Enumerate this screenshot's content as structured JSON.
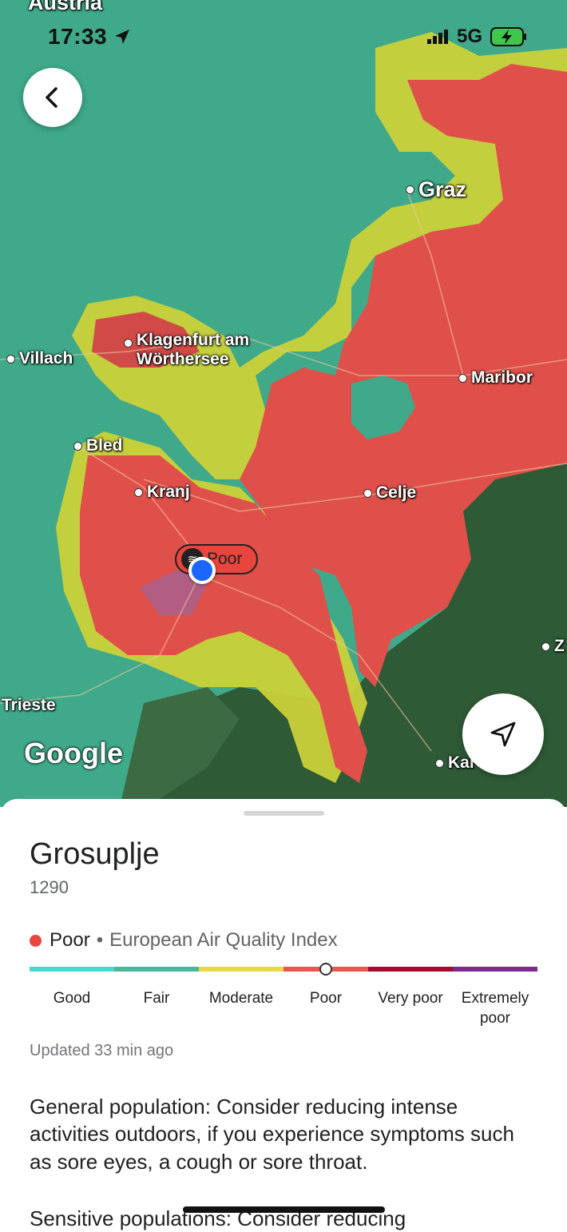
{
  "status_bar": {
    "time": "17:33",
    "network": "5G"
  },
  "map": {
    "top_label": "Austria",
    "cities": {
      "graz": "Graz",
      "klagenfurt": "Klagenfurt am\nWörthersee",
      "villach": "Villach",
      "maribor": "Maribor",
      "bled": "Bled",
      "kranj": "Kranj",
      "celje": "Celje",
      "trieste": "Trieste",
      "karlovac": "Kar",
      "zagreb": "Z"
    },
    "marker_label": "Poor",
    "attribution": "Google",
    "colors": {
      "good": "#3fa98a",
      "moderate": "#d8d43a",
      "poor": "#e0504a",
      "forest": "#2f5a36"
    }
  },
  "sheet": {
    "place": "Grosuplje",
    "postal": "1290",
    "status": "Poor",
    "separator": "•",
    "index_name": "European Air Quality Index",
    "scale": [
      {
        "label": "Good",
        "color": "#4fd6cc"
      },
      {
        "label": "Fair",
        "color": "#48b79a"
      },
      {
        "label": "Moderate",
        "color": "#e7d94a"
      },
      {
        "label": "Poor",
        "color": "#e8574f"
      },
      {
        "label": "Very poor",
        "color": "#9b1030"
      },
      {
        "label": "Extremely poor",
        "color": "#7a2a8c"
      }
    ],
    "current_level_fraction": 0.583,
    "updated": "Updated 33 min ago",
    "advice_general": "General population: Consider reducing intense activities outdoors, if you experience symptoms such as sore eyes, a cough or sore throat.",
    "advice_sensitive": "Sensitive populations: Consider reducing"
  },
  "icons": {
    "back": "chevron-left-icon",
    "my_location": "navigation-arrow-icon",
    "marker": "air-quality-icon",
    "location_services": "location-arrow-icon",
    "signal": "signal-bars-icon",
    "battery": "battery-charging-icon"
  }
}
